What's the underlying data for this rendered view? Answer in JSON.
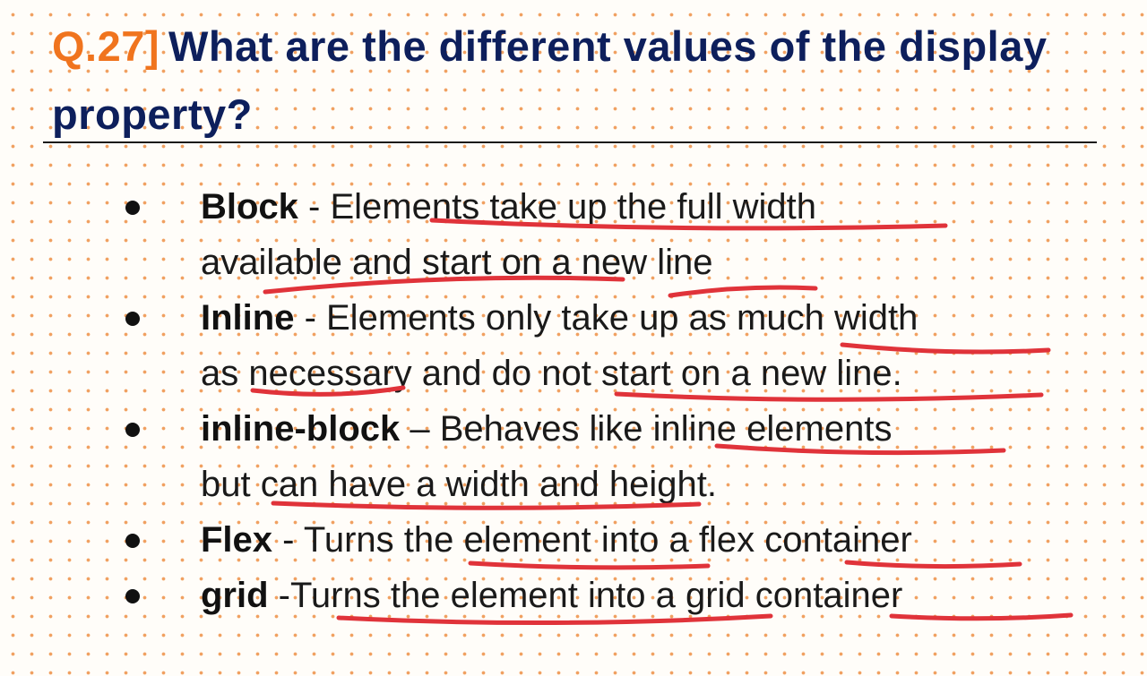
{
  "question": {
    "number": "Q.27]",
    "text": "What are the different values of the display property?"
  },
  "items": [
    {
      "term": "Block",
      "sep": " - ",
      "line1": "Elements take up the full width",
      "line2": "available and start on a new line"
    },
    {
      "term": "Inline",
      "sep": " - ",
      "line1": "Elements only take up as much width",
      "line2": "as necessary and do not start on a new line."
    },
    {
      "term": "inline-block",
      "sep": " – ",
      "line1": "Behaves like inline elements",
      "line2": "but can have a width and height."
    },
    {
      "term": "Flex",
      "sep": " - ",
      "line1": "Turns the element into a flex container",
      "line2": ""
    },
    {
      "term": "grid",
      "sep": " -",
      "line1": "Turns the element into a grid container",
      "line2": ""
    }
  ],
  "colors": {
    "question_number": "#f0741e",
    "title": "#0d1f5c",
    "body_text": "#1a1a1a",
    "highlight_underline": "#e0333a",
    "dot_pattern": "#f0a060"
  }
}
